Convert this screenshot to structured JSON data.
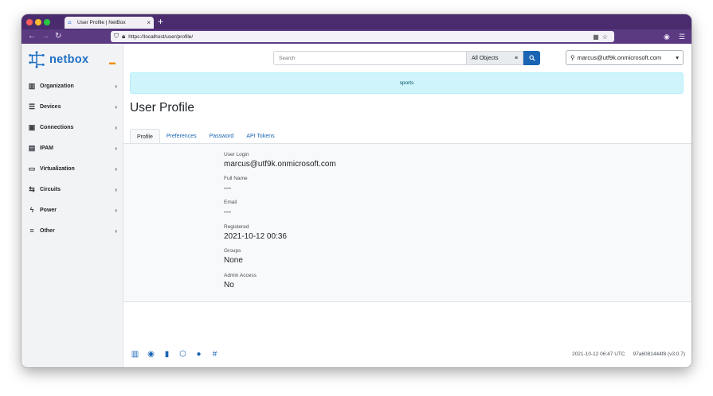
{
  "browser": {
    "tab_title": "User Profile | NetBox",
    "tab_close": "×",
    "new_tab": "+",
    "url": "https://localhost/user/profile/"
  },
  "brand": {
    "name": "netbox"
  },
  "sidebar": {
    "items": [
      {
        "label": "Organization",
        "icon": "organization-icon"
      },
      {
        "label": "Devices",
        "icon": "devices-icon"
      },
      {
        "label": "Connections",
        "icon": "connections-icon"
      },
      {
        "label": "IPAM",
        "icon": "ipam-icon"
      },
      {
        "label": "Virtualization",
        "icon": "virtualization-icon"
      },
      {
        "label": "Circuits",
        "icon": "circuits-icon"
      },
      {
        "label": "Power",
        "icon": "power-icon"
      },
      {
        "label": "Other",
        "icon": "other-icon"
      }
    ]
  },
  "search": {
    "placeholder": "Search",
    "scope": "All Objects"
  },
  "user_menu": {
    "label": "marcus@utf9k.onmicrosoft.com"
  },
  "banner": {
    "text": "sports"
  },
  "page": {
    "title": "User Profile"
  },
  "tabs": [
    {
      "label": "Profile"
    },
    {
      "label": "Preferences"
    },
    {
      "label": "Password"
    },
    {
      "label": "API Tokens"
    }
  ],
  "profile": {
    "user_login": {
      "label": "User Login",
      "value": "marcus@utf9k.onmicrosoft.com"
    },
    "full_name": {
      "label": "Full Name",
      "value": "—"
    },
    "email": {
      "label": "Email",
      "value": "—"
    },
    "registered": {
      "label": "Registered",
      "value": "2021-10-12 00:36"
    },
    "groups": {
      "label": "Groups",
      "value": "None"
    },
    "admin_access": {
      "label": "Admin Access",
      "value": "No"
    }
  },
  "footer": {
    "timestamp": "2021-10-12 06:47 UTC",
    "version": "97a6081444f8 (v3.0.7)"
  },
  "colors": {
    "browser_chrome": "#4a2c6e",
    "accent": "#1a64b4",
    "banner_bg": "#cff4fc"
  }
}
